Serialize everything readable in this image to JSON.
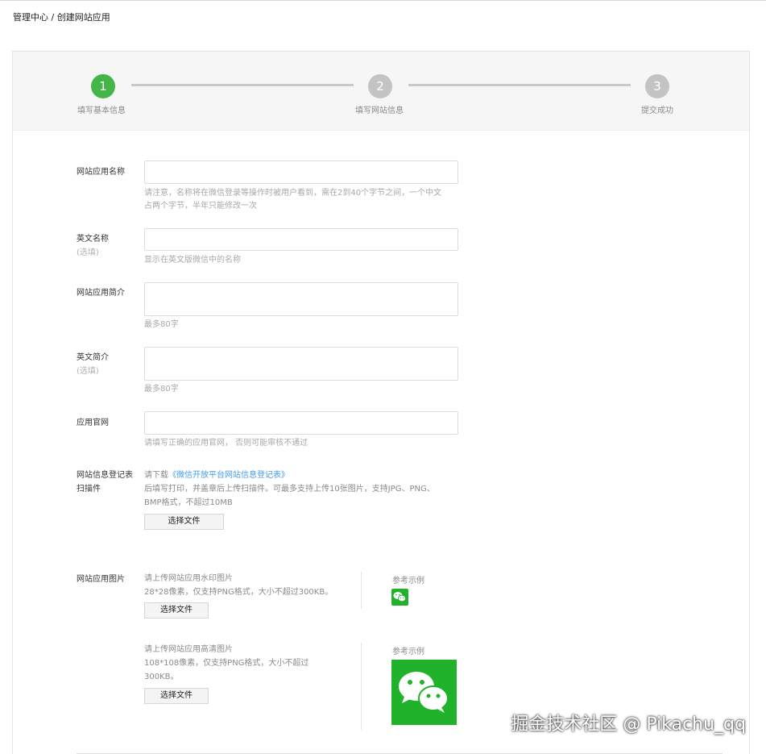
{
  "breadcrumb": "管理中心 / 创建网站应用",
  "steps": [
    {
      "num": "1",
      "label": "填写基本信息",
      "state": "active"
    },
    {
      "num": "2",
      "label": "填写网站信息",
      "state": "inactive"
    },
    {
      "num": "3",
      "label": "提交成功",
      "state": "inactive"
    }
  ],
  "colors": {
    "accent": "#44b549",
    "step_inactive": "#c4c4c4",
    "link": "#459ae9",
    "wechat_green": "#20b22b"
  },
  "form": {
    "app_name": {
      "label": "网站应用名称",
      "value": "",
      "hint_line1": "请注意，名称将在微信登录等操作时被用户看到，需在2到40个字节之间，一个中文",
      "hint_line2": "占两个字节，半年只能修改一次"
    },
    "en_name": {
      "label": "英文名称",
      "optional": "(选填)",
      "value": "",
      "hint": "显示在英文版微信中的名称"
    },
    "intro": {
      "label": "网站应用简介",
      "value": "",
      "hint": "最多80字"
    },
    "en_intro": {
      "label": "英文简介",
      "optional": "(选填)",
      "value": "",
      "hint": "最多80字"
    },
    "website": {
      "label": "应用官网",
      "value": "",
      "hint": "请填写正确的应用官网， 否则可能审核不通过"
    },
    "scan": {
      "label_line1": "网站信息登记表",
      "label_line2": "扫描件",
      "prefix": "请下载",
      "link": "《微信开放平台网站信息登记表》",
      "line2": "后填写打印，并盖章后上传扫描件。可最多支持上传10张图片，支持JPG、PNG、",
      "line3": "BMP格式，不超过10MB",
      "button": "选择文件"
    },
    "images": {
      "label": "网站应用图片",
      "small": {
        "line1": "请上传网站应用水印图片",
        "line2": "28*28像素，仅支持PNG格式，大小不超过300KB。",
        "button": "选择文件",
        "ref": "参考示例",
        "icon": "wechat-logo-icon"
      },
      "large": {
        "line1": "请上传网站应用高清图片",
        "line2": "108*108像素，仅支持PNG格式，大小不超过",
        "line3": "300KB。",
        "button": "选择文件",
        "ref": "参考示例",
        "icon": "wechat-logo-icon"
      }
    }
  },
  "watermark": "掘金技术社区 @ Pikachu_qq"
}
